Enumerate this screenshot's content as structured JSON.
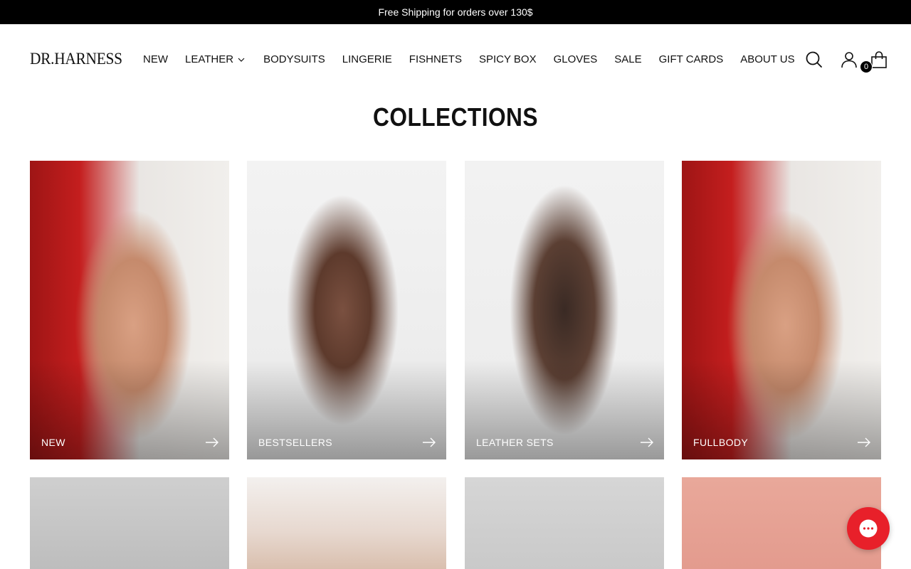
{
  "announcement": "Free Shipping for orders over 130$",
  "logo": "DR.HARNESS",
  "nav": {
    "items": [
      "NEW",
      "LEATHER",
      "BODYSUITS",
      "LINGERIE",
      "FISHNETS",
      "SPICY BOX",
      "GLOVES",
      "SALE",
      "GIFT CARDS",
      "ABOUT US"
    ]
  },
  "cart": {
    "count": "0"
  },
  "page_title": "COLLECTIONS",
  "collections": [
    {
      "label": "NEW"
    },
    {
      "label": "BESTSELLERS"
    },
    {
      "label": "LEATHER SETS"
    },
    {
      "label": "FULLBODY"
    }
  ],
  "icons": [
    "search-icon",
    "account-icon",
    "cart-icon",
    "chevron-down-icon",
    "arrow-right-icon",
    "chat-icon"
  ],
  "colors": {
    "announcement_bg": "#000000",
    "chat_button": "#e8202a"
  }
}
